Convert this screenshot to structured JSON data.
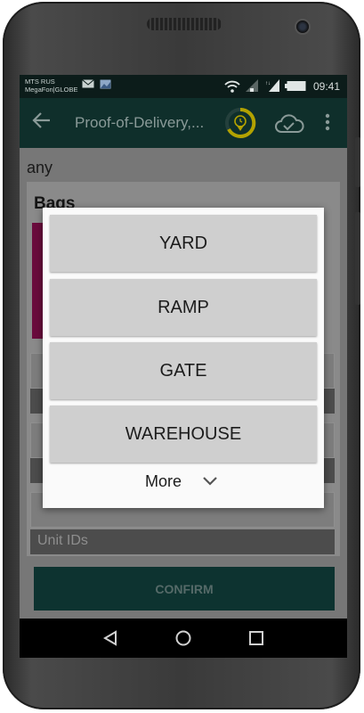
{
  "status_bar": {
    "carrier_line1": "MTS RUS",
    "carrier_line2": "MegaFon|GLOBE",
    "time": "09:41"
  },
  "app_bar": {
    "title": "Proof-of-Delivery,...",
    "icons": [
      "back-arrow-icon",
      "timer-icon",
      "cloud-check-icon",
      "more-vert-icon"
    ],
    "accent": "#c9b000"
  },
  "background": {
    "filter_text": "any",
    "section_title": "Bags",
    "unit_ids_placeholder": "Unit IDs",
    "confirm_label": "CONFIRM"
  },
  "dialog": {
    "options": [
      "YARD",
      "RAMP",
      "GATE",
      "WAREHOUSE"
    ],
    "more_label": "More"
  },
  "colors": {
    "status_bar": "#0c1c1a",
    "app_bar": "#0f2f2b",
    "section_stripe": "#6a0b3d",
    "option_bg": "#cfcfcf"
  }
}
